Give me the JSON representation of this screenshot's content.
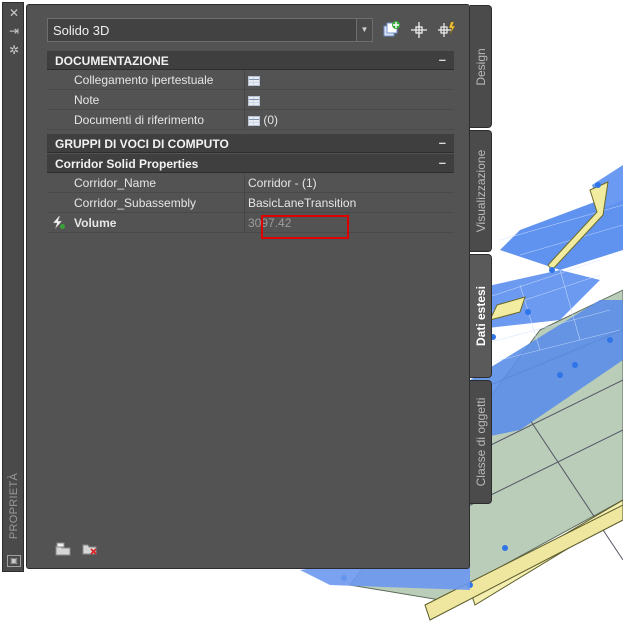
{
  "palette": {
    "title": "PROPRIETÀ",
    "object_type": "Solido 3D",
    "toolbar": {
      "icons": [
        "toggle-pickadd-icon",
        "select-objects-icon",
        "quick-select-icon"
      ]
    },
    "categories": [
      {
        "title": "DOCUMENTAZIONE",
        "toggle": "–",
        "rows": [
          {
            "name": "Collegamento ipertestuale",
            "value": ""
          },
          {
            "name": "Note",
            "value": ""
          },
          {
            "name": "Documenti di riferimento",
            "value": "(0)"
          }
        ]
      },
      {
        "title": "GRUPPI DI VOCI DI COMPUTO",
        "toggle": "–",
        "rows": []
      },
      {
        "title": "Corridor Solid Properties",
        "toggle": "–",
        "rows": [
          {
            "name": "Corridor_Name",
            "value": "Corridor - (1)"
          },
          {
            "name": "Corridor_Subassembly",
            "value": "BasicLaneTransition"
          },
          {
            "name": "Volume",
            "value": "3097.42"
          }
        ]
      }
    ],
    "tabs": [
      "Design",
      "Visualizzazione",
      "Dati estesi",
      "Classe di oggetti"
    ],
    "active_tab": "Dati estesi",
    "highlight_color": "#e00000"
  }
}
